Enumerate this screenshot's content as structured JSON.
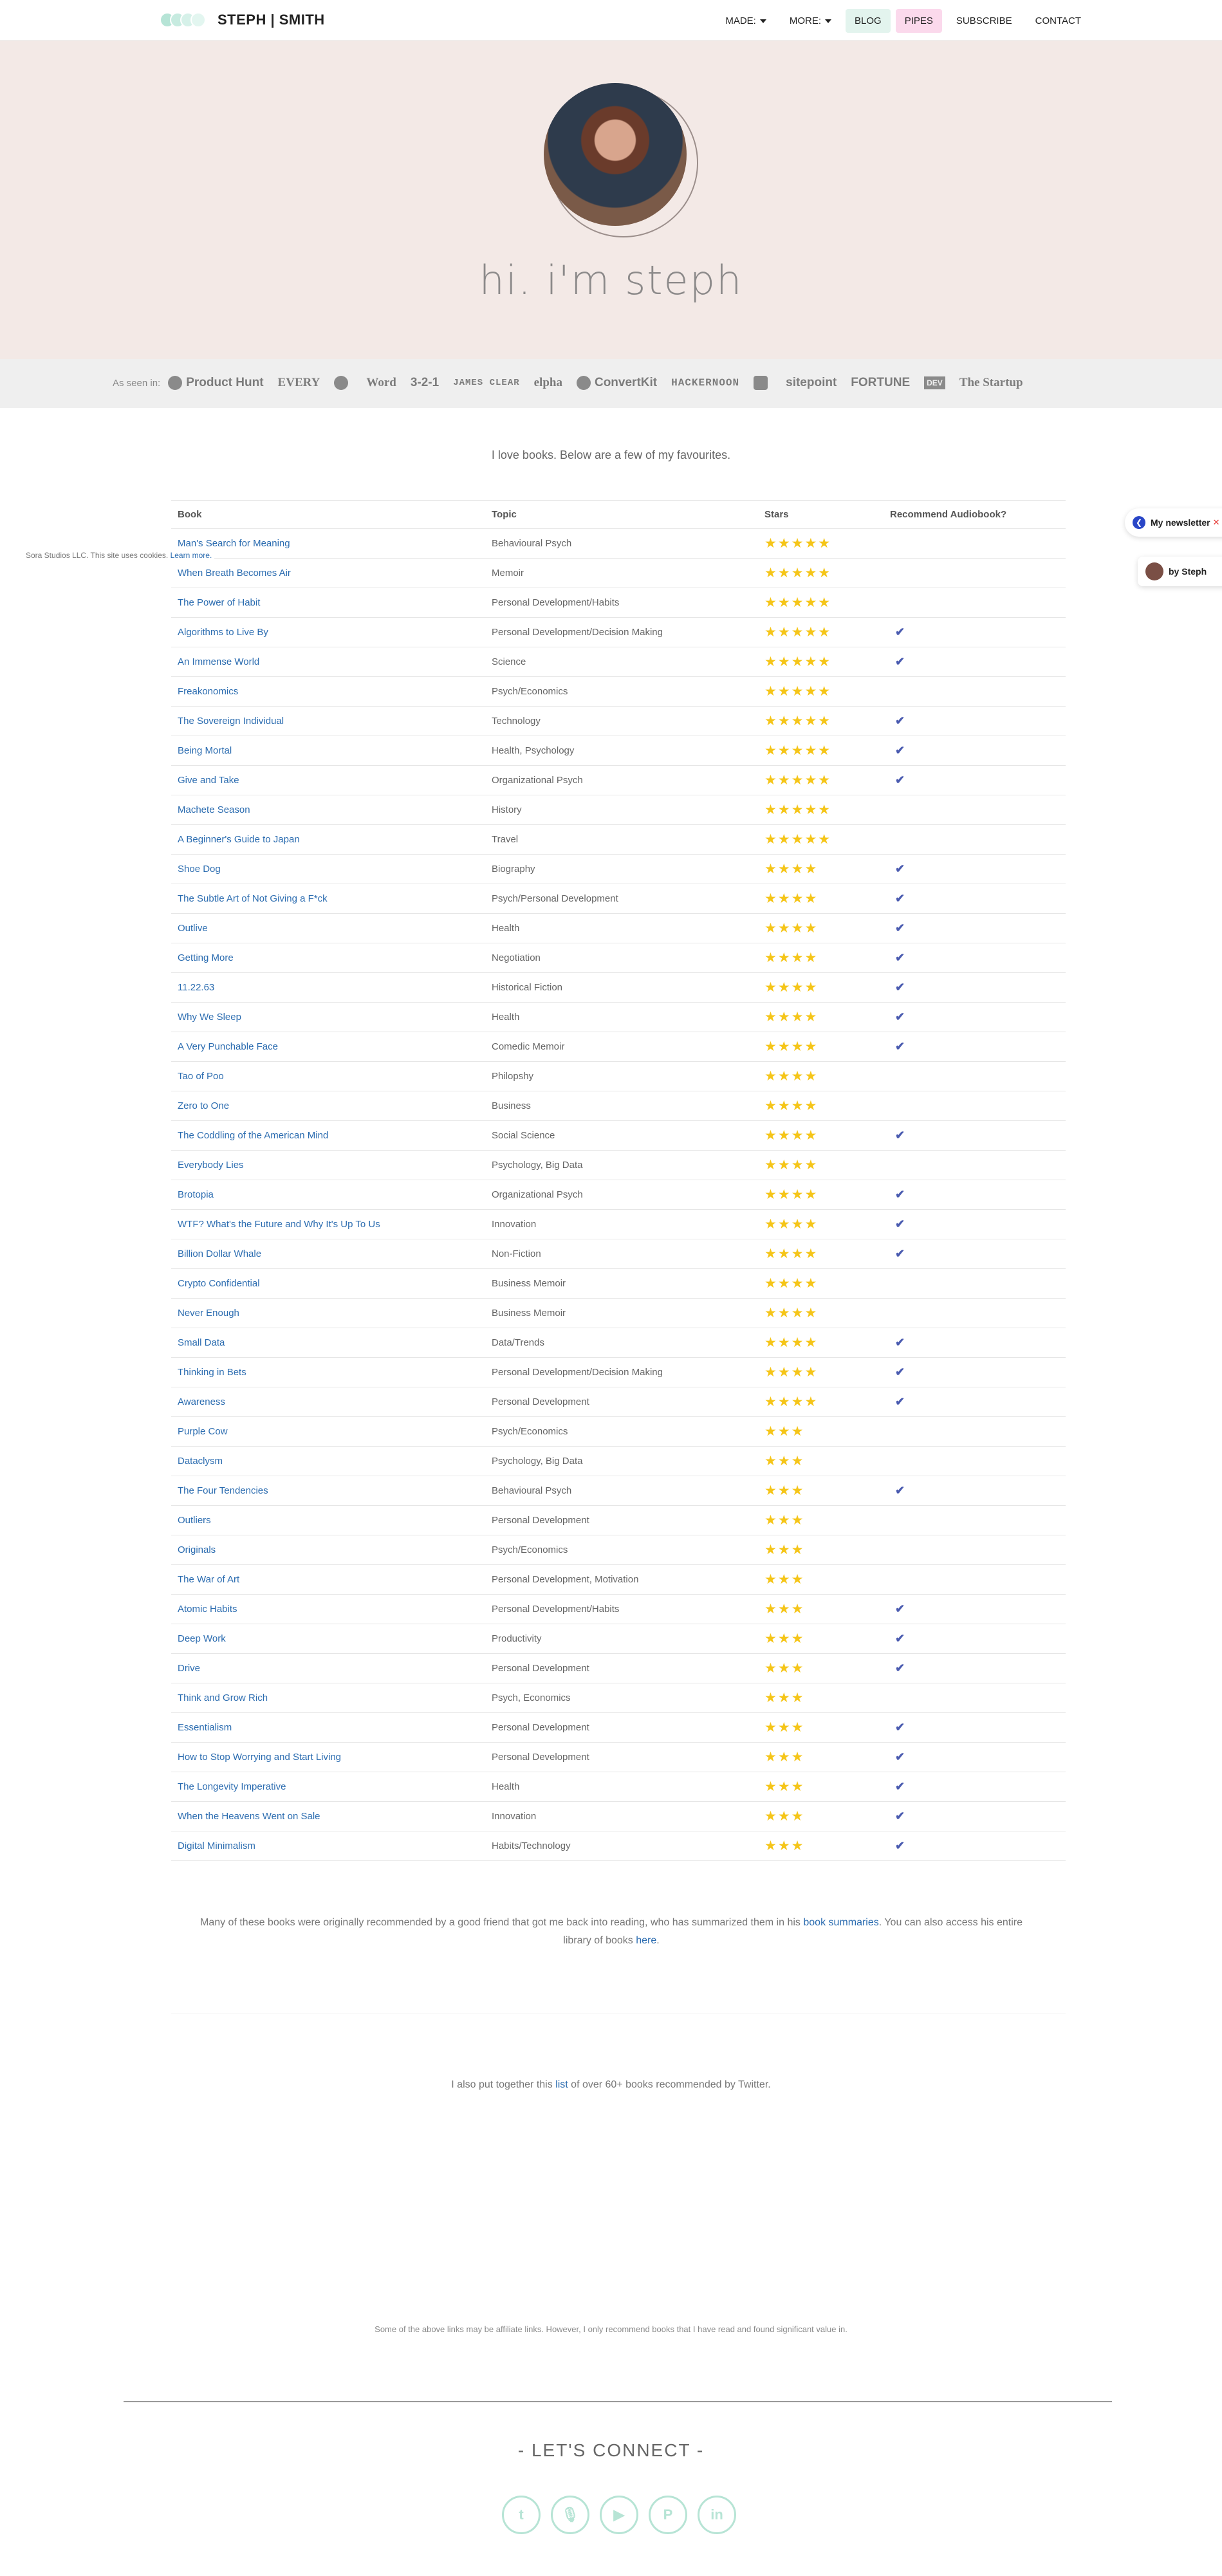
{
  "nav": {
    "logo": "STEPH | SMITH",
    "items": [
      "MADE:",
      "MORE:",
      "BLOG",
      "PIPES",
      "SUBSCRIBE",
      "CONTACT"
    ]
  },
  "hero": {
    "title": "hi. i'm steph"
  },
  "seen_in": {
    "label": "As seen in:",
    "logos": [
      "Product Hunt",
      "EVERY",
      "Y",
      "Word",
      "3-2-1",
      "JAMES CLEAR",
      "elpha",
      "ConvertKit",
      "HACKERNOON",
      "sitepoint",
      "FORTUNE",
      "DEV",
      "The Startup"
    ]
  },
  "intro": "I love books. Below are a few of my favourites.",
  "cookie": {
    "text": "Sora Studios LLC. This site uses cookies.",
    "link": "Learn more."
  },
  "widgets": {
    "newsletter": "My newsletter",
    "by": "by Steph"
  },
  "table": {
    "headers": [
      "Book",
      "Topic",
      "Stars",
      "Recommend Audiobook?"
    ],
    "rows": [
      {
        "book": "Man's Search for Meaning",
        "topic": "Behavioural Psych",
        "stars": "★★★★★",
        "audio": ""
      },
      {
        "book": "When Breath Becomes Air",
        "topic": "Memoir",
        "stars": "★★★★★",
        "audio": ""
      },
      {
        "book": "The Power of Habit",
        "topic": "Personal Development/Habits",
        "stars": "★★★★★",
        "audio": ""
      },
      {
        "book": "Algorithms to Live By",
        "topic": "Personal Development/Decision Making",
        "stars": "★★★★★",
        "audio": "✔"
      },
      {
        "book": "An Immense World",
        "topic": "Science",
        "stars": "★★★★★",
        "audio": "✔"
      },
      {
        "book": "Freakonomics",
        "topic": "Psych/Economics",
        "stars": "★★★★★",
        "audio": ""
      },
      {
        "book": "The Sovereign Individual",
        "topic": "Technology",
        "stars": "★★★★★",
        "audio": "✔"
      },
      {
        "book": "Being Mortal",
        "topic": "Health, Psychology",
        "stars": "★★★★★",
        "audio": "✔"
      },
      {
        "book": "Give and Take",
        "topic": "Organizational Psych",
        "stars": "★★★★★",
        "audio": "✔"
      },
      {
        "book": "Machete Season",
        "topic": "History",
        "stars": "★★★★★",
        "audio": ""
      },
      {
        "book": "A Beginner's Guide to Japan",
        "topic": "Travel",
        "stars": "★★★★★",
        "audio": ""
      },
      {
        "book": "Shoe Dog",
        "topic": "Biography",
        "stars": "★★★★",
        "audio": "✔"
      },
      {
        "book": "The Subtle Art of Not Giving a F*ck",
        "topic": "Psych/Personal Development",
        "stars": "★★★★",
        "audio": "✔"
      },
      {
        "book": "Outlive",
        "topic": "Health",
        "stars": "★★★★",
        "audio": "✔"
      },
      {
        "book": "Getting More",
        "topic": "Negotiation",
        "stars": "★★★★",
        "audio": "✔"
      },
      {
        "book": "11.22.63",
        "topic": "Historical Fiction",
        "stars": "★★★★",
        "audio": "✔"
      },
      {
        "book": "Why We Sleep",
        "topic": "Health",
        "stars": "★★★★",
        "audio": "✔"
      },
      {
        "book": "A Very Punchable Face",
        "topic": "Comedic Memoir",
        "stars": "★★★★",
        "audio": "✔"
      },
      {
        "book": "Tao of Poo",
        "topic": "Philopshy",
        "stars": "★★★★",
        "audio": ""
      },
      {
        "book": "Zero to One",
        "topic": "Business",
        "stars": "★★★★",
        "audio": ""
      },
      {
        "book": "The Coddling of the American Mind",
        "topic": "Social Science",
        "stars": "★★★★",
        "audio": "✔"
      },
      {
        "book": "Everybody Lies",
        "topic": "Psychology, Big Data",
        "stars": "★★★★",
        "audio": ""
      },
      {
        "book": "Brotopia",
        "topic": "Organizational Psych",
        "stars": "★★★★",
        "audio": "✔"
      },
      {
        "book": "WTF? What's the Future and Why It's Up To Us",
        "topic": "Innovation",
        "stars": "★★★★",
        "audio": "✔"
      },
      {
        "book": "Billion Dollar Whale",
        "topic": "Non-Fiction",
        "stars": "★★★★",
        "audio": "✔"
      },
      {
        "book": "Crypto Confidential",
        "topic": "Business Memoir",
        "stars": "★★★★",
        "audio": ""
      },
      {
        "book": "Never Enough",
        "topic": "Business Memoir",
        "stars": "★★★★",
        "audio": ""
      },
      {
        "book": "Small Data",
        "topic": "Data/Trends",
        "stars": "★★★★",
        "audio": "✔"
      },
      {
        "book": "Thinking in Bets",
        "topic": "Personal Development/Decision Making",
        "stars": "★★★★",
        "audio": "✔"
      },
      {
        "book": "Awareness",
        "topic": "Personal Development",
        "stars": "★★★★",
        "audio": "✔"
      },
      {
        "book": "Purple Cow",
        "topic": "Psych/Economics",
        "stars": "★★★",
        "audio": ""
      },
      {
        "book": "Dataclysm",
        "topic": "Psychology, Big Data",
        "stars": "★★★",
        "audio": ""
      },
      {
        "book": "The Four Tendencies",
        "topic": "Behavioural Psych",
        "stars": "★★★",
        "audio": "✔"
      },
      {
        "book": "Outliers",
        "topic": "Personal Development",
        "stars": "★★★",
        "audio": ""
      },
      {
        "book": "Originals",
        "topic": "Psych/Economics",
        "stars": "★★★",
        "audio": ""
      },
      {
        "book": "The War of Art",
        "topic": "Personal Development, Motivation",
        "stars": "★★★",
        "audio": ""
      },
      {
        "book": "Atomic Habits",
        "topic": "Personal Development/Habits",
        "stars": "★★★",
        "audio": "✔"
      },
      {
        "book": "Deep Work",
        "topic": "Productivity",
        "stars": "★★★",
        "audio": "✔"
      },
      {
        "book": "Drive",
        "topic": "Personal Development",
        "stars": "★★★",
        "audio": "✔"
      },
      {
        "book": "Think and Grow Rich",
        "topic": "Psych, Economics",
        "stars": "★★★",
        "audio": ""
      },
      {
        "book": "Essentialism",
        "topic": "Personal Development",
        "stars": "★★★",
        "audio": "✔"
      },
      {
        "book": "How to Stop Worrying and Start Living",
        "topic": "Personal Development",
        "stars": "★★★",
        "audio": "✔"
      },
      {
        "book": "The Longevity Imperative",
        "topic": "Health",
        "stars": "★★★",
        "audio": "✔"
      },
      {
        "book": "When the Heavens Went on Sale",
        "topic": "Innovation",
        "stars": "★★★",
        "audio": "✔"
      },
      {
        "book": "Digital Minimalism",
        "topic": "Habits/Technology",
        "stars": "★★★",
        "audio": "✔"
      }
    ]
  },
  "note": {
    "part1": "Many of these books were originally recommended by a good friend that got me back into reading, who has summarized them in his ",
    "link1": "book summaries",
    "part2": ". You can also access his entire library of books ",
    "link2": "here",
    "part3": "."
  },
  "list_note": {
    "part1": "I also put together this ",
    "link": "list",
    "part2": " of over 60+ books recommended by Twitter."
  },
  "affiliate": "Some of the above links may be affiliate links. However, I only recommend books that I have read and found significant value in.",
  "connect": "- LET'S CONNECT -",
  "socials": [
    {
      "icon": "twitter-icon",
      "glyph": "t"
    },
    {
      "icon": "microphone-icon",
      "glyph": "🎙"
    },
    {
      "icon": "youtube-icon",
      "glyph": "▶"
    },
    {
      "icon": "producthunt-icon",
      "glyph": "P"
    },
    {
      "icon": "linkedin-icon",
      "glyph": "in"
    }
  ]
}
